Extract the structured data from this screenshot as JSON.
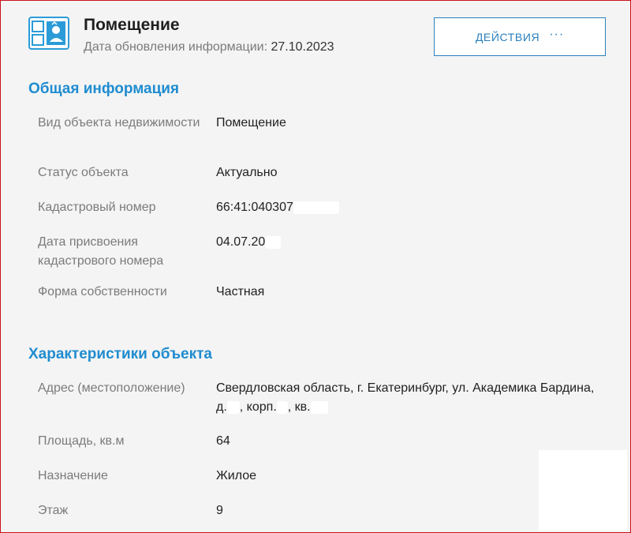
{
  "header": {
    "title": "Помещение",
    "updated_label": "Дата обновления информации:",
    "updated_value": "27.10.2023",
    "actions_label": "ДЕЙСТВИЯ",
    "actions_icon": "more-dots-icon"
  },
  "general": {
    "title": "Общая информация",
    "rows": [
      {
        "label": "Вид объекта недвижимости",
        "value": "Помещение"
      },
      {
        "label": "Статус объекта",
        "value": "Актуально"
      },
      {
        "label": "Кадастровый номер",
        "value": "66:41:040307"
      },
      {
        "label": "Дата присвоения кадастрового номера",
        "value": "04.07.20"
      },
      {
        "label": "Форма собственности",
        "value": "Частная"
      }
    ]
  },
  "characteristics": {
    "title": "Характеристики объекта",
    "rows": [
      {
        "label": "Адрес (местоположение)",
        "value_line1": "Свердловская область, г. Екатеринбург, ул. Академика Бардина,",
        "value_d": "д.",
        "value_korp": ", корп.",
        "value_kv": ", кв."
      },
      {
        "label": "Площадь, кв.м",
        "value": "64"
      },
      {
        "label": "Назначение",
        "value": "Жилое"
      },
      {
        "label": "Этаж",
        "value": "9"
      }
    ]
  },
  "colors": {
    "accent": "#1f8cd0",
    "button_border": "#2a80bd",
    "frame": "#c8101a",
    "background": "#f4f4f4"
  }
}
